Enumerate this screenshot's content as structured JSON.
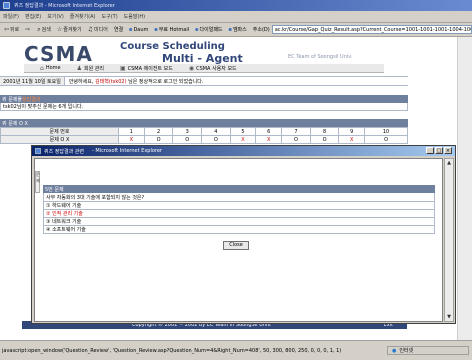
{
  "browser": {
    "title": "퀴즈 정답결과 - Microsoft Internet Explorer",
    "menus": [
      "파일(F)",
      "편집(E)",
      "보기(V)",
      "즐겨찾기(A)",
      "도구(T)",
      "도움말(H)"
    ],
    "toolbar": {
      "back": "뒤로",
      "search": "검색",
      "favorites": "즐겨찾기",
      "media": "미디어"
    },
    "address_label": "주소(D)",
    "address_value": "ac.kr/Course/Gap_Quiz_Result.asp?Current_Course=1001-1001-1001-1004-1002",
    "links": [
      {
        "icon": "e",
        "label": "연결"
      },
      {
        "icon": "e",
        "label": "Daum"
      },
      {
        "icon": "e",
        "label": "무료 Hotmail"
      },
      {
        "icon": "e",
        "label": "다이얼패드"
      },
      {
        "icon": "e",
        "label": "엠파스"
      }
    ],
    "status_text": "javascript:open_window('Question_Review', 'Question_Review.asp?Question_Num=4&Right_Num=408', 50, 300, 800, 250, 0, 0, 0, 1, 1)",
    "zone": "인터넷"
  },
  "site": {
    "logo": "CSMA",
    "banner_line1": "Course Scheduling",
    "banner_line2": "Multi - Agent",
    "banner_line3": "EC Team of Soongsil Univ.",
    "nav": [
      {
        "icon": "home-icon",
        "label": "Home"
      },
      {
        "icon": "member-icon",
        "label": "회원 관리"
      },
      {
        "icon": "agent-icon",
        "label": "CSMA 에이전트 모드"
      },
      {
        "icon": "user-icon",
        "label": "CSMA 사용자 모드"
      }
    ],
    "date": "2001년 11월 10일 토요일",
    "welcome_prefix": "안녕하세요,",
    "welcome_user": "김태혁(tsk02)",
    "welcome_suffix": "님은 정상적으로 로그인 되었습니다."
  },
  "result": {
    "header_prefix": "퀴 문제풀",
    "header_highlight": "정답결과",
    "body": "tsk02님이 맞추신 문제는 6개 입니다.",
    "ox_header": "퀴 문제 O X",
    "row1_label": "문제 번호",
    "row2_label": "문제 O X",
    "numbers": [
      "1",
      "2",
      "3",
      "4",
      "5",
      "6",
      "7",
      "8",
      "9",
      "10"
    ],
    "ox": [
      "X",
      "O",
      "O",
      "O",
      "X",
      "X",
      "O",
      "O",
      "X",
      "O"
    ]
  },
  "popup": {
    "icon_label": "e",
    "title": "퀴즈 정답결과 관련",
    "subtitle": "- Microsoft Internet Explorer",
    "side_tab": "문제",
    "question_header": "5번 문제",
    "question": "사무 자동화의 3대 기술에 포함되지 않는 것은?",
    "options": [
      "① 하드웨어 기술",
      "② 인적 관리 기술",
      "③ 네트워크 기술",
      "④ 소프트웨어 기술"
    ],
    "selected_index": 1,
    "close_label": "Close"
  },
  "footer": {
    "copyright": "Copyright © 2001 ~ 2002 by EC Team in SoongSil Univ.",
    "exit": "Exit"
  },
  "colors": {
    "section_header": "#6f7f9e",
    "footer": "#31477a",
    "highlight": "#ff8a3a",
    "error": "#cc0000"
  }
}
